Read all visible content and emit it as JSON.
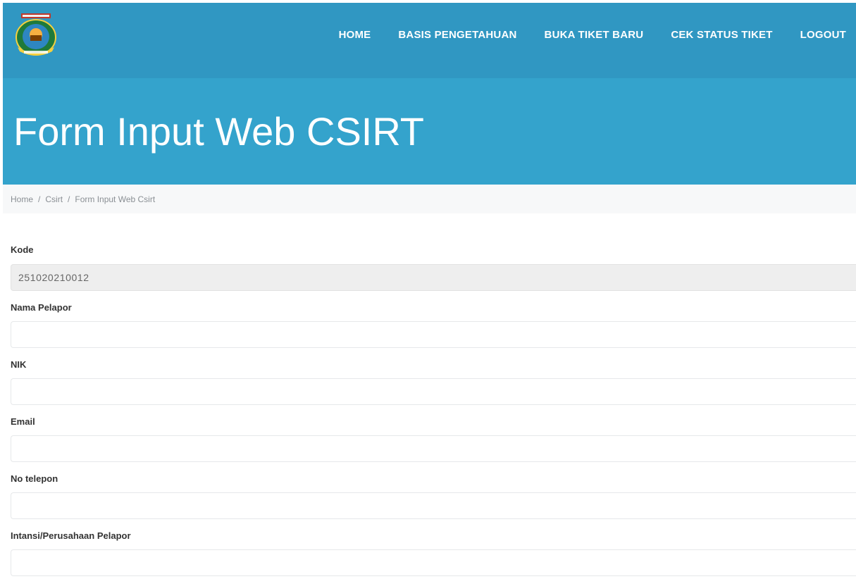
{
  "header": {
    "logo_icon": "government-emblem-logo",
    "nav": [
      {
        "label": "HOME"
      },
      {
        "label": "BASIS PENGETAHUAN"
      },
      {
        "label": "BUKA TIKET BARU"
      },
      {
        "label": "CEK STATUS TIKET"
      },
      {
        "label": "LOGOUT"
      }
    ],
    "colors": {
      "topbar": "#3097c2",
      "hero": "#34a3cc"
    }
  },
  "hero": {
    "title": "Form Input Web CSIRT"
  },
  "breadcrumb": {
    "items": [
      "Home",
      "Csirt",
      "Form Input Web Csirt"
    ],
    "separator": "/"
  },
  "form": {
    "fields": [
      {
        "label": "Kode",
        "value": "251020210012",
        "placeholder": "",
        "readonly": true
      },
      {
        "label": "Nama Pelapor",
        "value": "",
        "placeholder": ""
      },
      {
        "label": "NIK",
        "value": "",
        "placeholder": ""
      },
      {
        "label": "Email",
        "value": "",
        "placeholder": ""
      },
      {
        "label": "No telepon",
        "value": "",
        "placeholder": ""
      },
      {
        "label": "Intansi/Perusahaan Pelapor",
        "value": "",
        "placeholder": ""
      }
    ]
  }
}
